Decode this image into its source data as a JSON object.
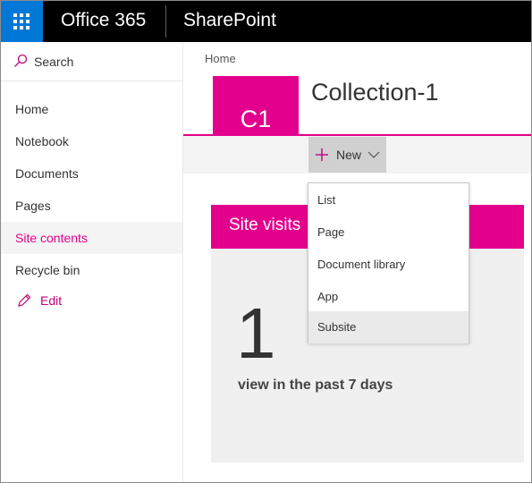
{
  "suite_bar": {
    "app_launcher_icon": "waffle-icon",
    "product_name": "Office 365",
    "app_name": "SharePoint",
    "brand_color": "#0078d7"
  },
  "left_nav": {
    "search_label": "Search",
    "items": [
      {
        "label": "Home"
      },
      {
        "label": "Notebook"
      },
      {
        "label": "Documents"
      },
      {
        "label": "Pages"
      },
      {
        "label": "Site contents",
        "selected": true
      },
      {
        "label": "Recycle bin"
      }
    ],
    "edit_label": "Edit"
  },
  "header": {
    "breadcrumb": "Home",
    "site_logo_text": "C1",
    "site_title": "Collection-1",
    "accent_color": "#e3008c"
  },
  "command_bar": {
    "new_label": "New"
  },
  "new_menu": {
    "items": [
      {
        "label": "List"
      },
      {
        "label": "Page"
      },
      {
        "label": "Document library"
      },
      {
        "label": "App"
      },
      {
        "label": "Subsite",
        "hovered": true
      }
    ]
  },
  "site_visits": {
    "title": "Site visits",
    "count": "1",
    "caption": "view in the past 7 days"
  }
}
